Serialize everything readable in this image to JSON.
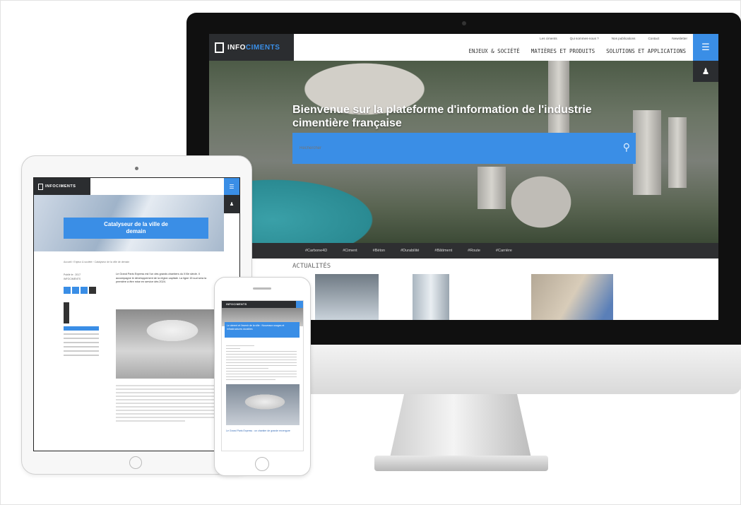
{
  "desktop": {
    "logo": {
      "part1": "INFO",
      "part2": "CIMENTS"
    },
    "util_links": [
      "Les ciments",
      "Qui sommes-nous ?",
      "Nos publications",
      "Contact",
      "Newsletter"
    ],
    "main_nav": [
      "ENJEUX & SOCIÉTÉ",
      "MATIÈRES ET PRODUITS",
      "SOLUTIONS ET APPLICATIONS"
    ],
    "hero_title_line1": "Bienvenue sur la plateforme d'information de l'industrie",
    "hero_title_line2": "cimentière française",
    "search_placeholder": "Rechercher",
    "tags": [
      "#Carbone4D",
      "#Ciment",
      "#Béton",
      "#Durabilité",
      "#Bâtiment",
      "#Route",
      "#Carrière"
    ],
    "news_title": "ACTUALITÉS"
  },
  "tablet": {
    "logo": {
      "part1": "INFO",
      "part2": "CIMENTS"
    },
    "banner_line1": "Catalyseur de la ville de",
    "banner_line2": "demain",
    "breadcrumb": "Accueil › Enjeux & société › Catalyseur de la ville de demain",
    "meta_date": "Publié le : 2017",
    "meta_author": "INFOCIMENTS",
    "intro": "Le Grand Paris Express est l'un des grands chantiers du XXIe siècle. Il accompagne le développement de la région capitale. La ligne 15 sud sera la première à être mise en service dès 2024."
  },
  "phone": {
    "logo": "INFOCIMENTS",
    "banner": "Le ciment et l'avenir de la ville : Nouveaux usages et infrastructures durables",
    "link": "Le Grand Paris Express : un chantier de grande envergure"
  },
  "colors": {
    "accent_blue": "#3a8ee6",
    "dark_nav": "#2b2d30",
    "tag_bar": "#2e2f31"
  }
}
